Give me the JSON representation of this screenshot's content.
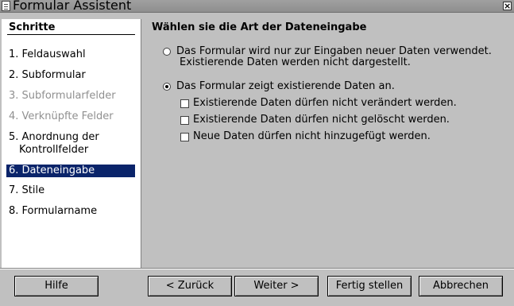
{
  "window": {
    "title": "Formular Assistent",
    "close_glyph": "×"
  },
  "steps": {
    "header": "Schritte",
    "items": [
      {
        "label": "1. Feldauswahl"
      },
      {
        "label": "2. Subformular"
      },
      {
        "label": "3. Subformularfelder"
      },
      {
        "label": "4. Verknüpfte Felder"
      },
      {
        "label_line1": "5. Anordnung der",
        "label_line2": "Kontrollfelder"
      },
      {
        "label": "6. Dateneingabe"
      },
      {
        "label": "7. Stile"
      },
      {
        "label": "8. Formularname"
      }
    ]
  },
  "content": {
    "title": "Wählen sie die Art der Dateneingabe",
    "option_new": {
      "line1": "Das Formular wird nur zur Eingaben neuer Daten verwendet.",
      "line2": "Existierende Daten werden nicht dargestellt.",
      "selected": false
    },
    "option_existing": {
      "label": "Das Formular zeigt existierende Daten an.",
      "selected": true
    },
    "checkboxes": [
      {
        "label": "Existierende Daten dürfen nicht verändert werden.",
        "checked": false
      },
      {
        "label": "Existierende Daten dürfen nicht gelöscht werden.",
        "checked": false
      },
      {
        "label": "Neue Daten dürfen nicht hinzugefügt werden.",
        "checked": false
      }
    ]
  },
  "buttons": {
    "help": "Hilfe",
    "back": "< Zurück",
    "next": "Weiter >",
    "finish": "Fertig stellen",
    "cancel": "Abbrechen"
  }
}
